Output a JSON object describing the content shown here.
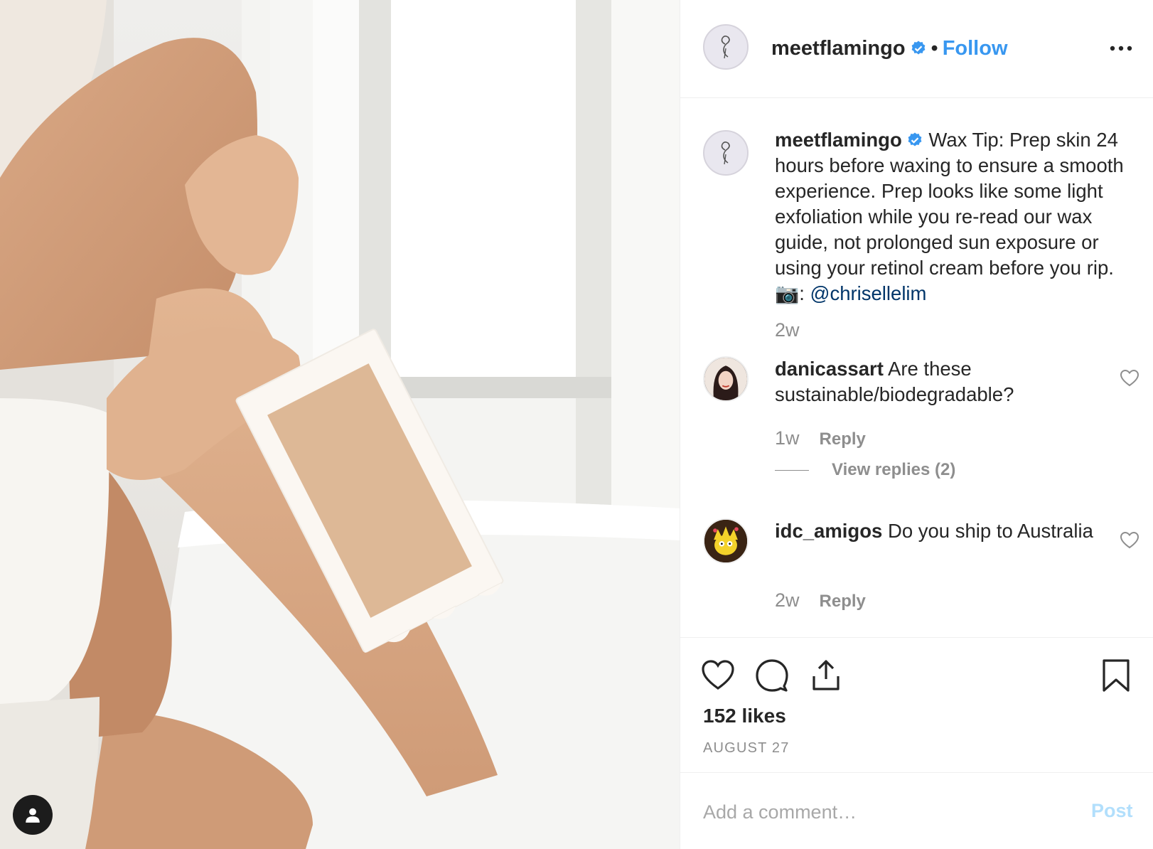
{
  "post": {
    "image_alt": "Person applying a wax strip to their lower leg, seated in a white bathtub by a bright window",
    "account": {
      "username": "meetflamingo",
      "verified": true,
      "separator": "•",
      "follow_label": "Follow",
      "more_icon": "more-horizontal-icon"
    },
    "caption": {
      "username": "meetflamingo",
      "text": "Wax Tip: Prep skin 24 hours before waxing to ensure a smooth experience. Prep looks like some light exfoliation while you re-read our wax guide, not prolonged sun exposure or using your retinol cream before you rip. 📷: ",
      "mention": "@chrisellelim",
      "time": "2w"
    },
    "comments": [
      {
        "username": "danicassart",
        "text": "Are these sustainable/biodegradable?",
        "time": "1w",
        "reply_label": "Reply",
        "view_replies_label": "View replies (2)"
      },
      {
        "username": "idc_amigos",
        "text": "Do you ship to Australia",
        "time": "2w",
        "reply_label": "Reply"
      }
    ],
    "likes_label": "152 likes",
    "date_label": "AUGUST 27",
    "add_comment": {
      "placeholder": "Add a comment…",
      "post_label": "Post"
    }
  },
  "colors": {
    "link_blue": "#3897f0",
    "mention_blue": "#003569",
    "post_disabled": "#b2dffc",
    "secondary_text": "#8e8e8e",
    "border": "#efefef"
  }
}
